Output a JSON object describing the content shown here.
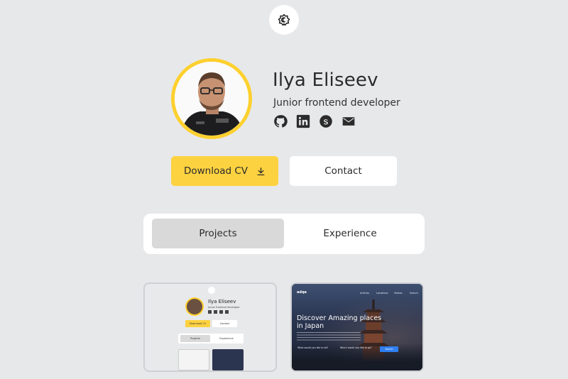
{
  "theme_toggle": {
    "icon": "sun-gear-icon"
  },
  "profile": {
    "name": "Ilya Eliseev",
    "title": "Junior frontend developer",
    "socials": [
      {
        "icon": "github-icon"
      },
      {
        "icon": "linkedin-icon"
      },
      {
        "icon": "skype-icon"
      },
      {
        "icon": "mail-icon"
      }
    ]
  },
  "actions": {
    "download_label": "Download CV",
    "contact_label": "Contact"
  },
  "tabs": [
    {
      "label": "Projects",
      "active": true
    },
    {
      "label": "Experience",
      "active": false
    }
  ],
  "projects": {
    "portfolio_preview": {
      "name": "Ilya Eliseev",
      "title": "Junior frontend developer",
      "download_label": "Download CV",
      "contact_label": "Contact",
      "tab1": "Projects",
      "tab2": "Experience"
    },
    "travel_preview": {
      "logo": "adqa",
      "nav": [
        "Articles",
        "Locations",
        "Videos",
        "Search"
      ],
      "headline": "Discover Amazing places in Japan",
      "question1": "What would you like to do?",
      "question2": "Which would you like to go?",
      "search_label": "Search"
    }
  },
  "colors": {
    "background": "#e7e8ea",
    "accent": "#fdd240",
    "surface": "#ffffff",
    "active_tab": "#d9d9d9"
  }
}
